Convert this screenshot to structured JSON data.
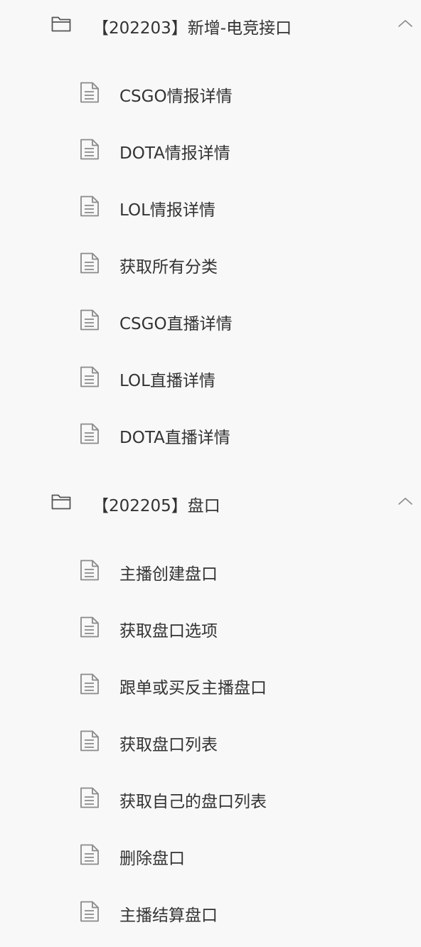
{
  "colors": {
    "background": "#f8f8f8",
    "text": "#333333",
    "icon": "#8a8a8a",
    "folder_icon": "#555555"
  },
  "groups": [
    {
      "title": "【202203】新增-电竞接口",
      "icon": "folder-open-icon",
      "expanded": true,
      "items": [
        {
          "label": "CSGO情报详情",
          "icon": "document-icon"
        },
        {
          "label": "DOTA情报详情",
          "icon": "document-icon"
        },
        {
          "label": "LOL情报详情",
          "icon": "document-icon"
        },
        {
          "label": "获取所有分类",
          "icon": "document-icon"
        },
        {
          "label": "CSGO直播详情",
          "icon": "document-icon"
        },
        {
          "label": "LOL直播详情",
          "icon": "document-icon"
        },
        {
          "label": "DOTA直播详情",
          "icon": "document-icon"
        }
      ]
    },
    {
      "title": "【202205】盘口",
      "icon": "folder-open-icon",
      "expanded": true,
      "items": [
        {
          "label": "主播创建盘口",
          "icon": "document-icon"
        },
        {
          "label": "获取盘口选项",
          "icon": "document-icon"
        },
        {
          "label": "跟单或买反主播盘口",
          "icon": "document-icon"
        },
        {
          "label": "获取盘口列表",
          "icon": "document-icon"
        },
        {
          "label": "获取自己的盘口列表",
          "icon": "document-icon"
        },
        {
          "label": "删除盘口",
          "icon": "document-icon"
        },
        {
          "label": "主播结算盘口",
          "icon": "document-icon"
        }
      ]
    }
  ]
}
